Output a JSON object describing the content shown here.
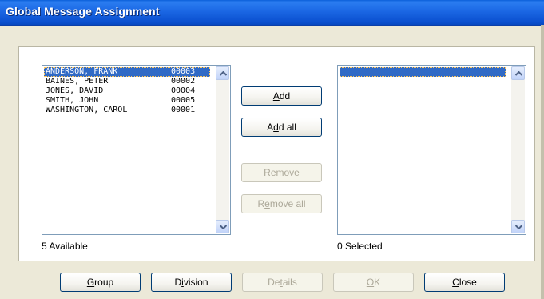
{
  "window": {
    "title": "Global Message Assignment"
  },
  "available_list": {
    "items": [
      {
        "name": "ANDERSON, FRANK",
        "code": "00003",
        "selected": true
      },
      {
        "name": "BAINES, PETER",
        "code": "00002",
        "selected": false
      },
      {
        "name": "JONES, DAVID",
        "code": "00004",
        "selected": false
      },
      {
        "name": "SMITH, JOHN",
        "code": "00005",
        "selected": false
      },
      {
        "name": "WASHINGTON, CAROL",
        "code": "00001",
        "selected": false
      }
    ],
    "status": "5 Available"
  },
  "selected_list": {
    "items": [],
    "status": "0 Selected"
  },
  "transfer_buttons": {
    "add": {
      "pre": "",
      "key": "A",
      "post": "dd",
      "enabled": true
    },
    "add_all": {
      "pre": "A",
      "key": "d",
      "post": "d all",
      "enabled": true
    },
    "remove": {
      "pre": "",
      "key": "R",
      "post": "emove",
      "enabled": false
    },
    "remove_all": {
      "pre": "R",
      "key": "e",
      "post": "move all",
      "enabled": false
    }
  },
  "footer_buttons": {
    "group": {
      "pre": "",
      "key": "G",
      "post": "roup",
      "enabled": true
    },
    "division": {
      "pre": "D",
      "key": "i",
      "post": "vision",
      "enabled": true
    },
    "details": {
      "pre": "De",
      "key": "t",
      "post": "ails",
      "enabled": false
    },
    "ok": {
      "pre": "",
      "key": "O",
      "post": "K",
      "enabled": false
    },
    "close": {
      "pre": "",
      "key": "C",
      "post": "lose",
      "enabled": true
    }
  },
  "colors": {
    "titlebar": "#0A4FCF",
    "selection": "#316AC5",
    "dialog_bg": "#ECE9D8",
    "disabled_text": "#ACA899"
  },
  "icons": {
    "scroll_up": "chevron-up-icon",
    "scroll_down": "chevron-down-icon"
  }
}
